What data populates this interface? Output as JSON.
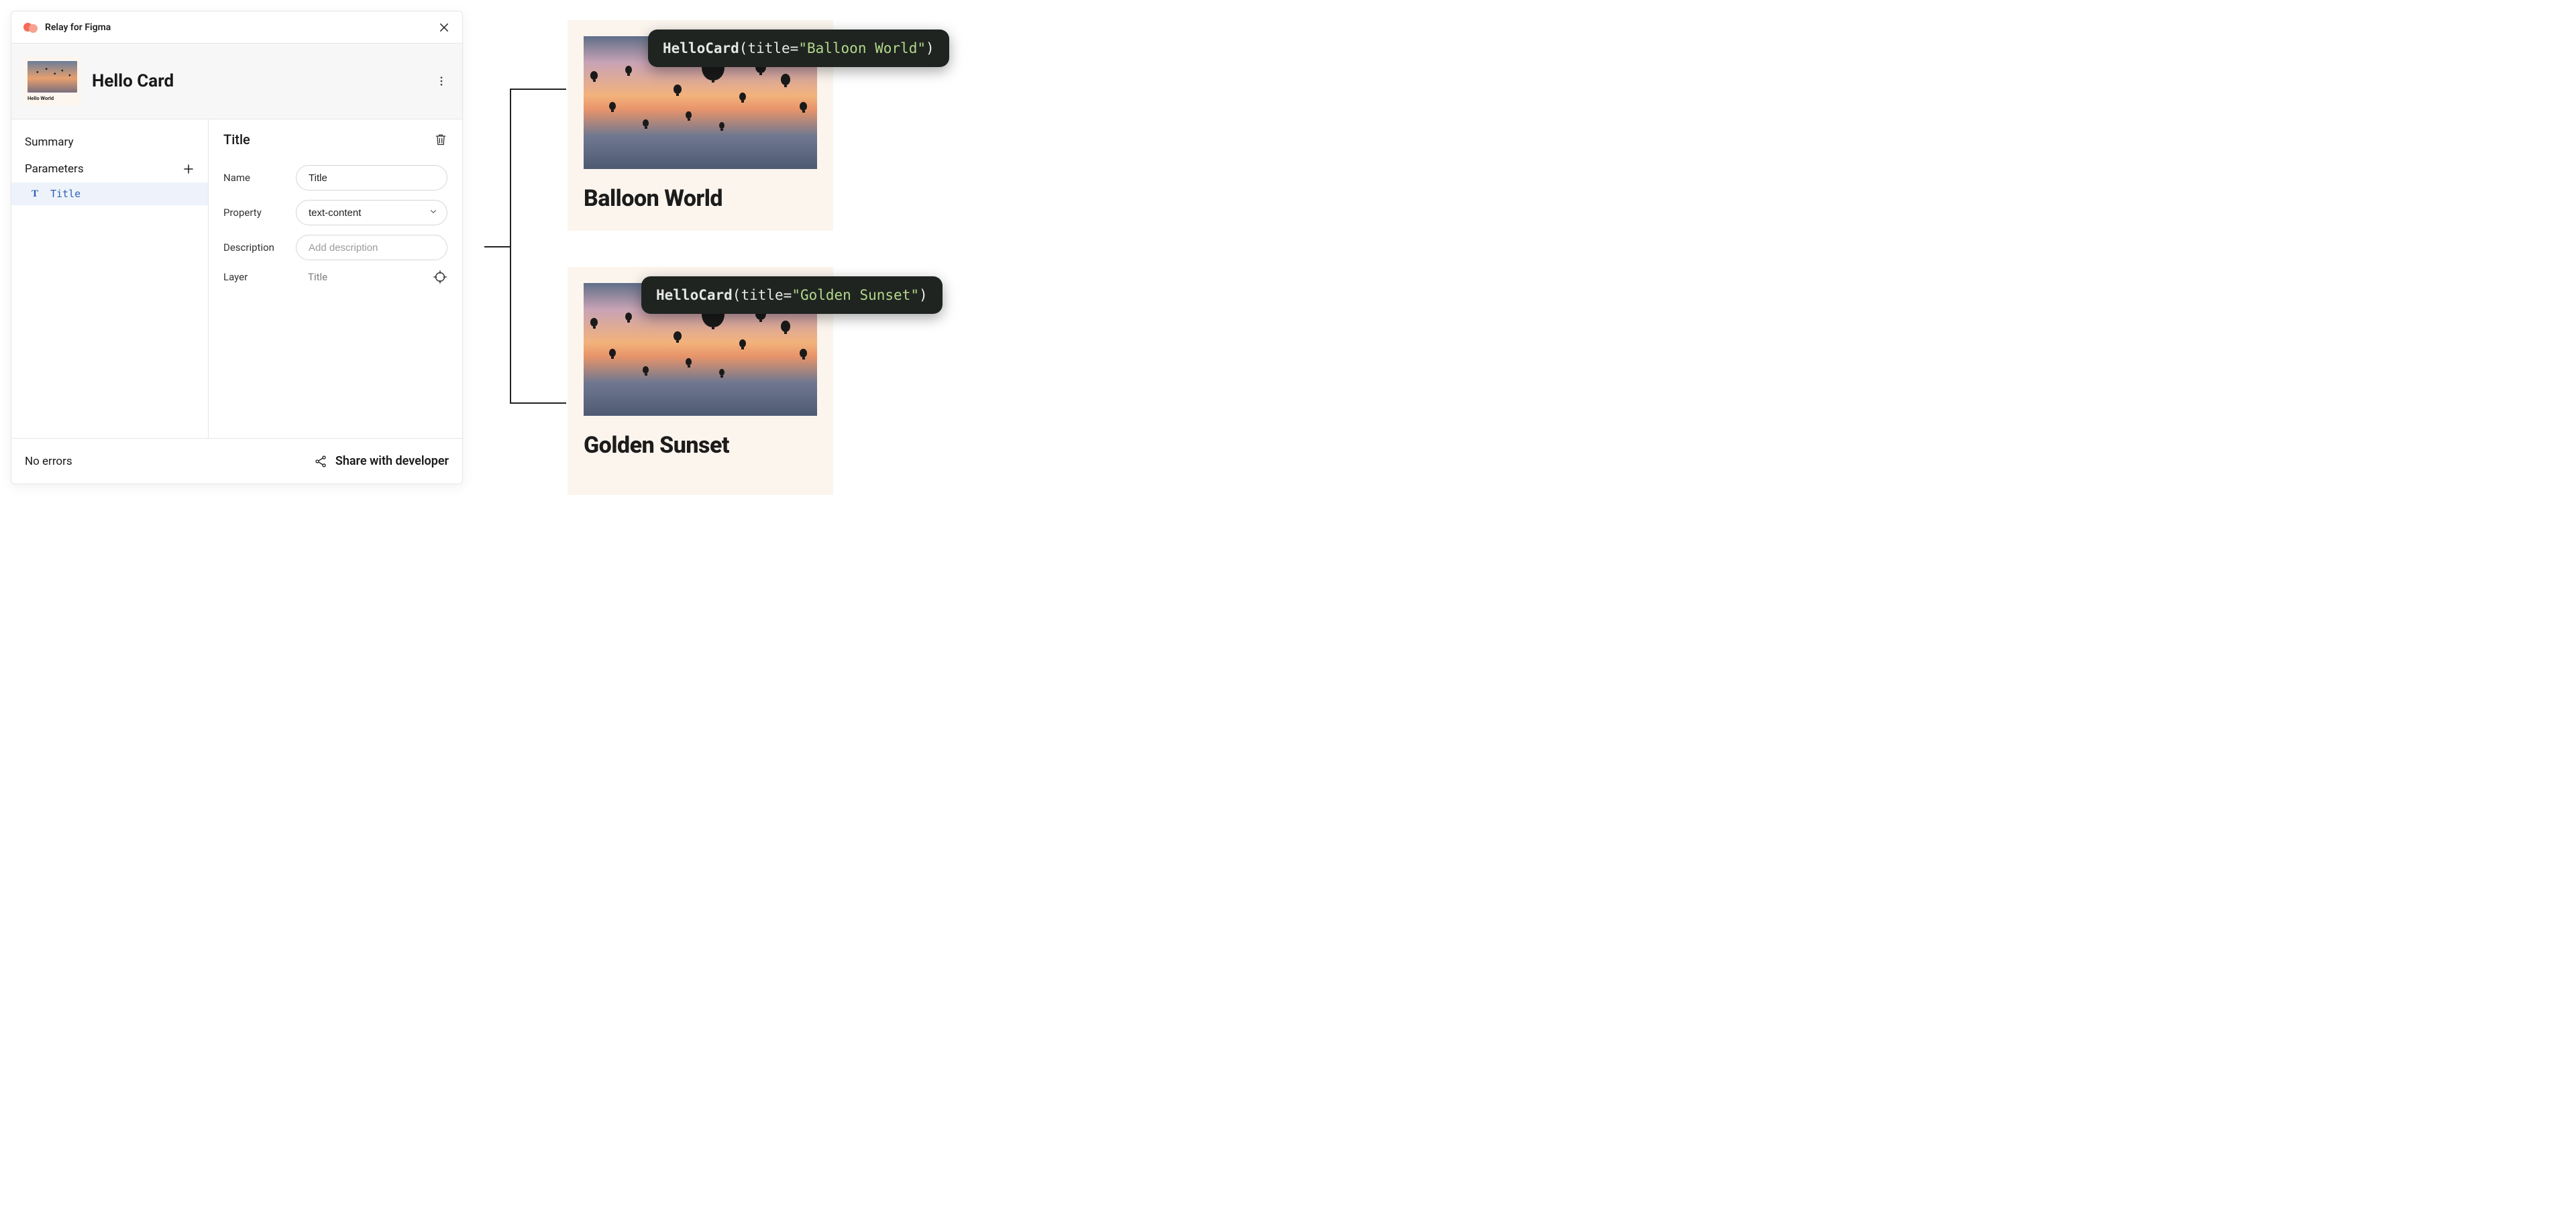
{
  "plugin": {
    "title": "Relay for Figma"
  },
  "component": {
    "name": "Hello Card",
    "thumb_caption": "Hello World"
  },
  "sidebar": {
    "summary_label": "Summary",
    "parameters_label": "Parameters",
    "items": [
      {
        "label": "Title"
      }
    ]
  },
  "detail": {
    "heading": "Title",
    "fields": {
      "name_label": "Name",
      "name_value": "Title",
      "property_label": "Property",
      "property_value": "text-content",
      "description_label": "Description",
      "description_placeholder": "Add description",
      "layer_label": "Layer",
      "layer_value": "Title"
    }
  },
  "footer": {
    "status": "No errors",
    "share_label": "Share with developer"
  },
  "previews": {
    "card1": {
      "code_fn": "HelloCard",
      "code_arg": "title",
      "code_val": "\"Balloon World\"",
      "title": "Balloon World"
    },
    "card2": {
      "code_fn": "HelloCard",
      "code_arg": "title",
      "code_val": "\"Golden Sunset\"",
      "title": "Golden Sunset"
    }
  }
}
